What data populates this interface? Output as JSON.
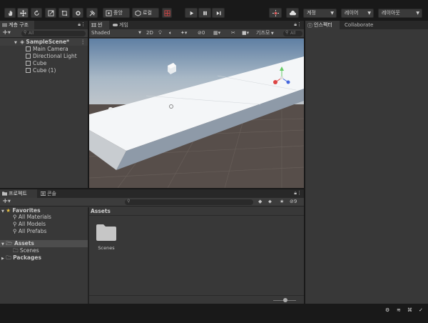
{
  "toolbar": {
    "center_label": "중앙",
    "local_label": "로컬",
    "account_label": "계정",
    "layers_label": "레이어",
    "layout_label": "레이아웃"
  },
  "hierarchy": {
    "tab": "계층 구조",
    "search_placeholder": "All",
    "scene": "SampleScene*",
    "items": [
      "Main Camera",
      "Directional Light",
      "Cube",
      "Cube (1)"
    ]
  },
  "scene_view": {
    "tab_scene": "씬",
    "tab_game": "게임",
    "shading": "Shaded",
    "mode_2d": "2D",
    "hidden_count": "0",
    "gizmos": "기즈모",
    "search_placeholder": "All"
  },
  "inspector": {
    "tab": "인스펙터",
    "collab_tab": "Collaborate"
  },
  "project": {
    "tab_project": "프로젝트",
    "tab_console": "콘솔",
    "hidden_count": "9",
    "favorites_label": "Favorites",
    "favorites": [
      "All Materials",
      "All Models",
      "All Prefabs"
    ],
    "assets_label": "Assets",
    "assets_children": [
      "Scenes"
    ],
    "packages_label": "Packages",
    "breadcrumb": "Assets",
    "files": [
      "Scenes"
    ]
  },
  "colors": {
    "accent": "#2c5d87",
    "panel": "#383838",
    "dark": "#191919"
  }
}
